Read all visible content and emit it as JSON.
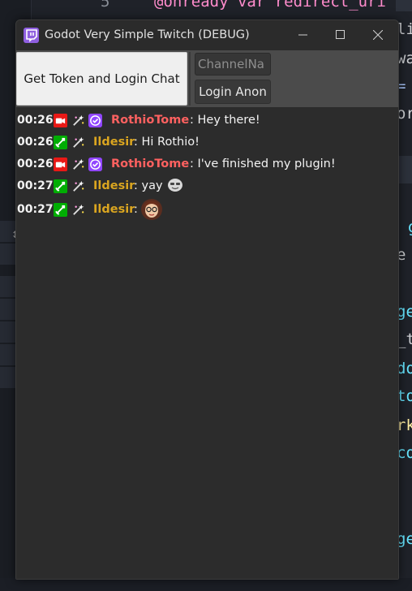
{
  "window": {
    "title": "Godot Very Simple Twitch (DEBUG)",
    "app_icon": "twitch-logo-icon",
    "controls": [
      "minimize-icon",
      "maximize-icon",
      "close-icon"
    ]
  },
  "toolbar": {
    "login_chat_label": "Get Token and Login Chat",
    "channel_value": "ChannelNa",
    "login_anon_label": "Login Anon"
  },
  "chat": {
    "messages": [
      {
        "time": "00:26",
        "badges": [
          "broadcaster-badge-icon",
          "sparkle-badge-icon",
          "verified-badge-icon"
        ],
        "user": "RothioTome",
        "user_color": "#ff6160",
        "separator": ":",
        "text": " Hey there!"
      },
      {
        "time": "00:26",
        "badges": [
          "moderator-badge-icon",
          "sparkle-badge-icon"
        ],
        "user": "Ildesir",
        "user_color": "#daa520",
        "separator": ":",
        "text": " Hi Rothio!"
      },
      {
        "time": "00:26",
        "badges": [
          "broadcaster-badge-icon",
          "sparkle-badge-icon",
          "verified-badge-icon"
        ],
        "user": "RothioTome",
        "user_color": "#ff6160",
        "separator": ":",
        "text": " I've finished my plugin!"
      },
      {
        "time": "00:27",
        "badges": [
          "moderator-badge-icon",
          "sparkle-badge-icon"
        ],
        "user": "Ildesir",
        "user_color": "#daa520",
        "separator": ":",
        "text": " yay",
        "emote": "face-emote-icon"
      },
      {
        "time": "00:27",
        "badges": [
          "moderator-badge-icon",
          "sparkle-badge-icon"
        ],
        "user": "Ildesir",
        "user_color": "#daa520",
        "separator": ":",
        "text": "",
        "emote": "avatar-emote-icon"
      }
    ]
  },
  "background_editor": {
    "line_number": "5",
    "lines": [
      "@onready var redirect_uri",
      "li",
      "wa",
      "=",
      "or",
      "g",
      "e",
      "ge",
      "_t",
      "do",
      "to",
      "rk",
      "co",
      "ge"
    ],
    "gutter_glyph": "↕"
  },
  "colors": {
    "broadcaster": "#e91916",
    "moderator": "#00ad03",
    "verified": "#9146ff",
    "twitch": "#9146ff"
  }
}
